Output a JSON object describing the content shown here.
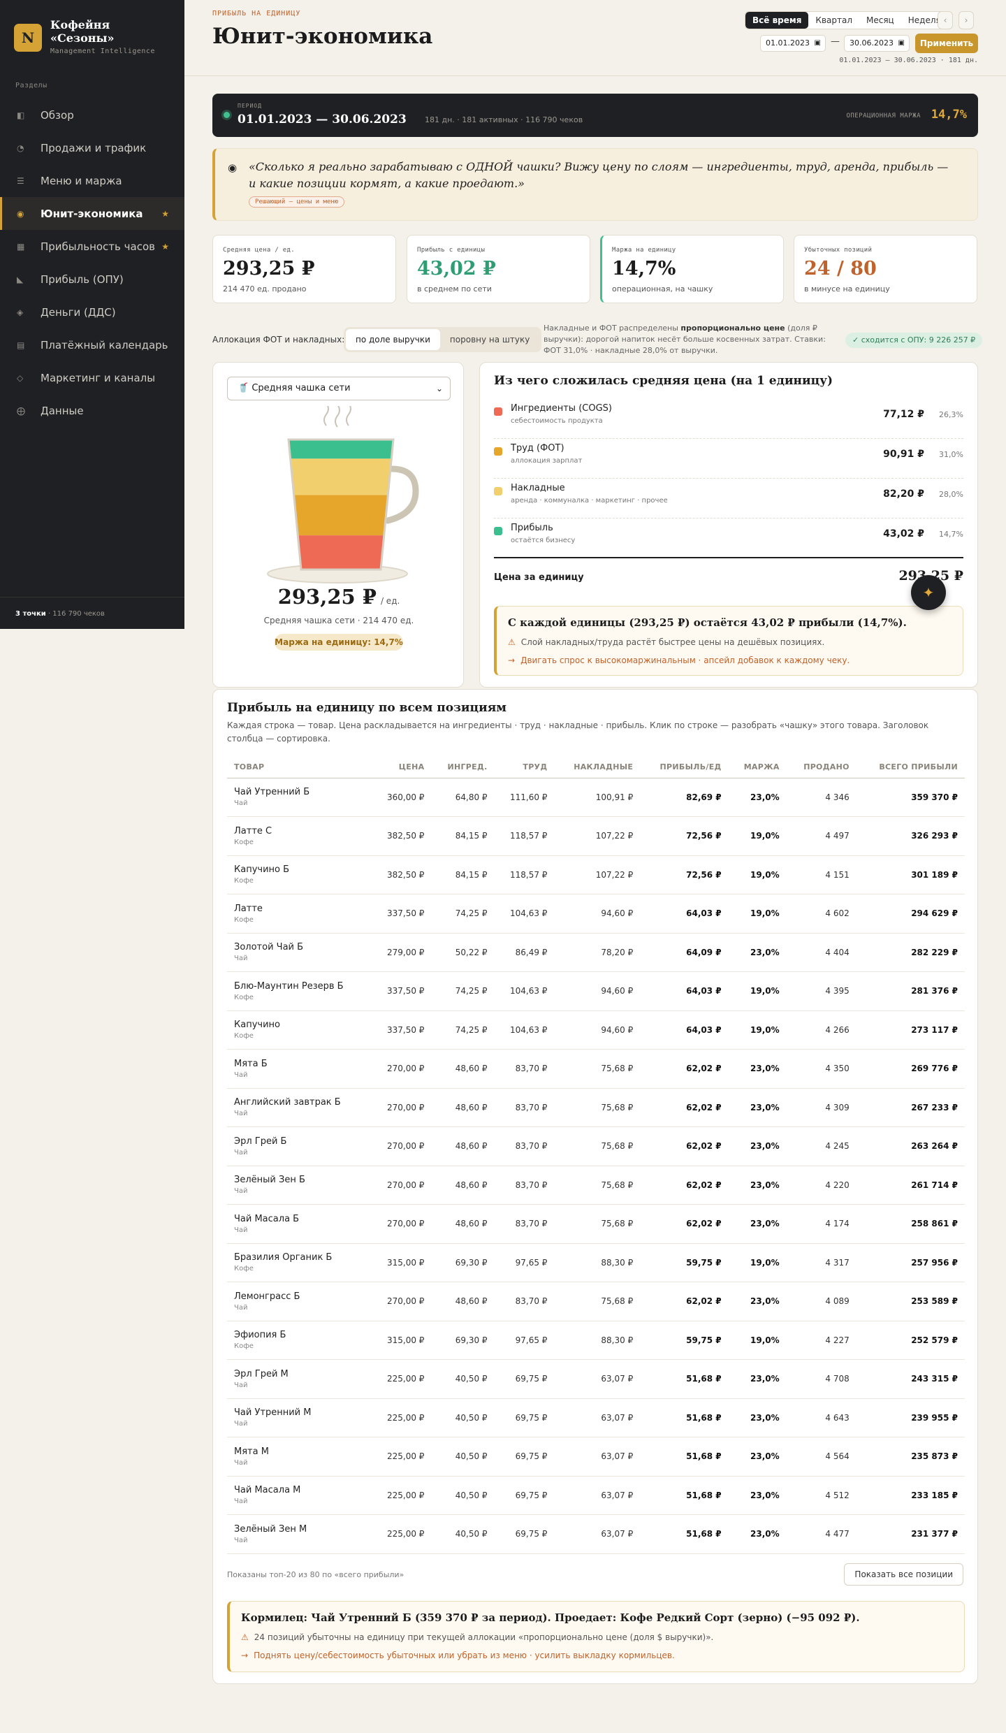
{
  "brand": {
    "logo": "N",
    "name_line1": "Кофейня",
    "name_line2": "«Сезоны»",
    "subtitle": "Management Intelligence"
  },
  "sidebar": {
    "section_label": "Разделы",
    "items": [
      {
        "icon": "dashboard-icon",
        "glyph": "◧",
        "label": "Обзор",
        "active": false,
        "star": false
      },
      {
        "icon": "trend-icon",
        "glyph": "◔",
        "label": "Продажи и трафик",
        "active": false,
        "star": false
      },
      {
        "icon": "menu-icon",
        "glyph": "☰",
        "label": "Меню и маржа",
        "active": false,
        "star": false
      },
      {
        "icon": "coin-icon",
        "glyph": "◉",
        "label": "Юнит-экономика",
        "active": true,
        "star": true
      },
      {
        "icon": "hours-icon",
        "glyph": "▦",
        "label": "Прибыльность часов",
        "active": false,
        "star": true
      },
      {
        "icon": "chart-icon",
        "glyph": "◣",
        "label": "Прибыль (ОПУ)",
        "active": false,
        "star": false
      },
      {
        "icon": "money-icon",
        "glyph": "◈",
        "label": "Деньги (ДДС)",
        "active": false,
        "star": false
      },
      {
        "icon": "calendar-icon",
        "glyph": "▤",
        "label": "Платёжный календарь",
        "active": false,
        "star": false
      },
      {
        "icon": "marketing-icon",
        "glyph": "◇",
        "label": "Маркетинг и каналы",
        "active": false,
        "star": false
      },
      {
        "icon": "data-icon",
        "glyph": "⨁",
        "label": "Данные",
        "active": false,
        "star": false
      }
    ],
    "star_glyph": "★",
    "footer_points": "3 точки",
    "footer_checks": " · 116 790 чеков"
  },
  "header": {
    "eyebrow": "ПРИБЫЛЬ НА ЕДИНИЦУ",
    "title": "Юнит-экономика",
    "periods": [
      "Всё время",
      "Квартал",
      "Месяц",
      "Неделя"
    ],
    "active_period": "Всё время",
    "prev": "‹",
    "next": "›",
    "date_from": "01.01.2023",
    "date_to": "30.06.2023",
    "dash": "—",
    "apply": "Применить",
    "range_note": "01.01.2023 – 30.06.2023 · 181 дн."
  },
  "period_bar": {
    "label": "ПЕРИОД",
    "value": "01.01.2023 — 30.06.2023",
    "meta": "181 дн. · 181 активных · 116 790 чеков",
    "margin_label": "ОПЕРАЦИОННАЯ МАРЖА",
    "margin_value": "14,7%"
  },
  "quote": {
    "text": "«Сколько я реально зарабатываю с ОДНОЙ чашки? Вижу цену по слоям — ингредиенты, труд, аренда, прибыль — и какие позиции кормят, а какие проедают.»",
    "tag": "Решающий — цены и меню"
  },
  "kpis": [
    {
      "label": "Средняя цена / ед.",
      "value": "293,25 ₽",
      "sub": "214 470 ед. продано",
      "color": "#1b1b1b",
      "accent": "#e4ded2"
    },
    {
      "label": "Прибыль с единицы",
      "value": "43,02 ₽",
      "sub": "в среднем по сети",
      "color": "#2f9d73",
      "accent": "#e4ded2"
    },
    {
      "label": "Маржа на единицу",
      "value": "14,7%",
      "sub": "операционная, на чашку",
      "color": "#1b1b1b",
      "accent": "#3fc08e"
    },
    {
      "label": "Убыточных позиций",
      "value": "24 / 80",
      "sub": "в минусе на единицу",
      "color": "#c0622b",
      "accent": "#e4ded2"
    }
  ],
  "allocation": {
    "label": "Аллокация ФОТ и накладных:",
    "options": [
      "по доле выручки",
      "поровну на штуку"
    ],
    "active": "по доле выручки",
    "note_prefix": "Накладные и ФОТ распределены ",
    "note_bold": "пропорционально цене",
    "note_suffix": " (доля ₽ выручки): дорогой напиток несёт больше косвенных затрат. Ставки: ФОТ 31,0% · накладные 28,0% от выручки.",
    "badge": "✓ сходится с ОПУ: 9 226 257 ₽"
  },
  "cup": {
    "select_value": "🥤 Средняя чашка сети",
    "chevron": "⌄",
    "price": "293,25 ₽",
    "per": "/ ед.",
    "sub": "Средняя чашка сети · 214 470 ед.",
    "badge": "Маржа на единицу: 14,7%",
    "layers": [
      {
        "name": "profit",
        "share": 0.147,
        "color": "#3cbf8f"
      },
      {
        "name": "overhead",
        "share": 0.28,
        "color": "#f0cf6c"
      },
      {
        "name": "labor",
        "share": 0.31,
        "color": "#e5a62b"
      },
      {
        "name": "cogs",
        "share": 0.263,
        "color": "#ee6a55"
      }
    ]
  },
  "breakdown": {
    "title": "Из чего сложилась средняя цена (на 1 единицу)",
    "rows": [
      {
        "name": "Ингредиенты (COGS)",
        "desc": "себестоимость продукта",
        "value": "77,12 ₽",
        "pct": "26,3%",
        "color": "#ee6a55"
      },
      {
        "name": "Труд (ФОТ)",
        "desc": "аллокация зарплат",
        "value": "90,91 ₽",
        "pct": "31,0%",
        "color": "#e5a62b"
      },
      {
        "name": "Накладные",
        "desc": "аренда · коммуналка · маркетинг · прочее",
        "value": "82,20 ₽",
        "pct": "28,0%",
        "color": "#f0cf6c"
      },
      {
        "name": "Прибыль",
        "desc": "остаётся бизнесу",
        "value": "43,02 ₽",
        "pct": "14,7%",
        "color": "#3cbf8f"
      }
    ],
    "total_label": "Цена за единицу",
    "total_value": "293,25 ₽",
    "insight_title": "С каждой единицы (293,25 ₽) остаётся 43,02 ₽ прибыли (14,7%).",
    "insight_warn": "Слой накладных/труда растёт быстрее цены на дешёвых позициях.",
    "insight_action": "Двигать спрос к высокомаржинальным · апсейл добавок к каждому чеку.",
    "warn_glyph": "⚠",
    "action_glyph": "→",
    "fab_glyph": "✦"
  },
  "table": {
    "title": "Прибыль на единицу по всем позициям",
    "subtitle": "Каждая строка — товар. Цена раскладывается на ингредиенты · труд · накладные · прибыль. Клик по строке — разобрать «чашку» этого товара. Заголовок столбца — сортировка.",
    "columns": [
      "ТОВАР",
      "ЦЕНА",
      "ИНГРЕД.",
      "ТРУД",
      "НАКЛАДНЫЕ",
      "ПРИБЫЛЬ/ЕД",
      "МАРЖА",
      "ПРОДАНО",
      "ВСЕГО ПРИБЫЛИ"
    ],
    "rows": [
      [
        "Чай Утренний Б",
        "Чай",
        "360,00 ₽",
        "64,80 ₽",
        "111,60 ₽",
        "100,91 ₽",
        "82,69 ₽",
        "23,0%",
        "4 346",
        "359 370 ₽"
      ],
      [
        "Латте С",
        "Кофе",
        "382,50 ₽",
        "84,15 ₽",
        "118,57 ₽",
        "107,22 ₽",
        "72,56 ₽",
        "19,0%",
        "4 497",
        "326 293 ₽"
      ],
      [
        "Капучино Б",
        "Кофе",
        "382,50 ₽",
        "84,15 ₽",
        "118,57 ₽",
        "107,22 ₽",
        "72,56 ₽",
        "19,0%",
        "4 151",
        "301 189 ₽"
      ],
      [
        "Латте",
        "Кофе",
        "337,50 ₽",
        "74,25 ₽",
        "104,63 ₽",
        "94,60 ₽",
        "64,03 ₽",
        "19,0%",
        "4 602",
        "294 629 ₽"
      ],
      [
        "Золотой Чай Б",
        "Чай",
        "279,00 ₽",
        "50,22 ₽",
        "86,49 ₽",
        "78,20 ₽",
        "64,09 ₽",
        "23,0%",
        "4 404",
        "282 229 ₽"
      ],
      [
        "Блю-Маунтин Резерв Б",
        "Кофе",
        "337,50 ₽",
        "74,25 ₽",
        "104,63 ₽",
        "94,60 ₽",
        "64,03 ₽",
        "19,0%",
        "4 395",
        "281 376 ₽"
      ],
      [
        "Капучино",
        "Кофе",
        "337,50 ₽",
        "74,25 ₽",
        "104,63 ₽",
        "94,60 ₽",
        "64,03 ₽",
        "19,0%",
        "4 266",
        "273 117 ₽"
      ],
      [
        "Мята Б",
        "Чай",
        "270,00 ₽",
        "48,60 ₽",
        "83,70 ₽",
        "75,68 ₽",
        "62,02 ₽",
        "23,0%",
        "4 350",
        "269 776 ₽"
      ],
      [
        "Английский завтрак Б",
        "Чай",
        "270,00 ₽",
        "48,60 ₽",
        "83,70 ₽",
        "75,68 ₽",
        "62,02 ₽",
        "23,0%",
        "4 309",
        "267 233 ₽"
      ],
      [
        "Эрл Грей Б",
        "Чай",
        "270,00 ₽",
        "48,60 ₽",
        "83,70 ₽",
        "75,68 ₽",
        "62,02 ₽",
        "23,0%",
        "4 245",
        "263 264 ₽"
      ],
      [
        "Зелёный Зен Б",
        "Чай",
        "270,00 ₽",
        "48,60 ₽",
        "83,70 ₽",
        "75,68 ₽",
        "62,02 ₽",
        "23,0%",
        "4 220",
        "261 714 ₽"
      ],
      [
        "Чай Масала Б",
        "Чай",
        "270,00 ₽",
        "48,60 ₽",
        "83,70 ₽",
        "75,68 ₽",
        "62,02 ₽",
        "23,0%",
        "4 174",
        "258 861 ₽"
      ],
      [
        "Бразилия Органик Б",
        "Кофе",
        "315,00 ₽",
        "69,30 ₽",
        "97,65 ₽",
        "88,30 ₽",
        "59,75 ₽",
        "19,0%",
        "4 317",
        "257 956 ₽"
      ],
      [
        "Лемонграсс Б",
        "Чай",
        "270,00 ₽",
        "48,60 ₽",
        "83,70 ₽",
        "75,68 ₽",
        "62,02 ₽",
        "23,0%",
        "4 089",
        "253 589 ₽"
      ],
      [
        "Эфиопия Б",
        "Кофе",
        "315,00 ₽",
        "69,30 ₽",
        "97,65 ₽",
        "88,30 ₽",
        "59,75 ₽",
        "19,0%",
        "4 227",
        "252 579 ₽"
      ],
      [
        "Эрл Грей М",
        "Чай",
        "225,00 ₽",
        "40,50 ₽",
        "69,75 ₽",
        "63,07 ₽",
        "51,68 ₽",
        "23,0%",
        "4 708",
        "243 315 ₽"
      ],
      [
        "Чай Утренний М",
        "Чай",
        "225,00 ₽",
        "40,50 ₽",
        "69,75 ₽",
        "63,07 ₽",
        "51,68 ₽",
        "23,0%",
        "4 643",
        "239 955 ₽"
      ],
      [
        "Мята М",
        "Чай",
        "225,00 ₽",
        "40,50 ₽",
        "69,75 ₽",
        "63,07 ₽",
        "51,68 ₽",
        "23,0%",
        "4 564",
        "235 873 ₽"
      ],
      [
        "Чай Масала М",
        "Чай",
        "225,00 ₽",
        "40,50 ₽",
        "69,75 ₽",
        "63,07 ₽",
        "51,68 ₽",
        "23,0%",
        "4 512",
        "233 185 ₽"
      ],
      [
        "Зелёный Зен М",
        "Чай",
        "225,00 ₽",
        "40,50 ₽",
        "69,75 ₽",
        "63,07 ₽",
        "51,68 ₽",
        "23,0%",
        "4 477",
        "231 377 ₽"
      ]
    ],
    "footer_note": "Показаны топ-20 из 80 по «всего прибыли»",
    "show_all": "Показать все позиции",
    "verdict_title": "Кормилец: Чай Утренний Б (359 370 ₽ за период). Проедает: Кофе Редкий Сорт (зерно) (−95 092 ₽).",
    "verdict_warn": "24 позиций убыточны на единицу при текущей аллокации «пропорционально цене (доля $ выручки)».",
    "verdict_action": "Поднять цену/себестоимость убыточных или убрать из меню · усилить выкладку кормильцев."
  }
}
